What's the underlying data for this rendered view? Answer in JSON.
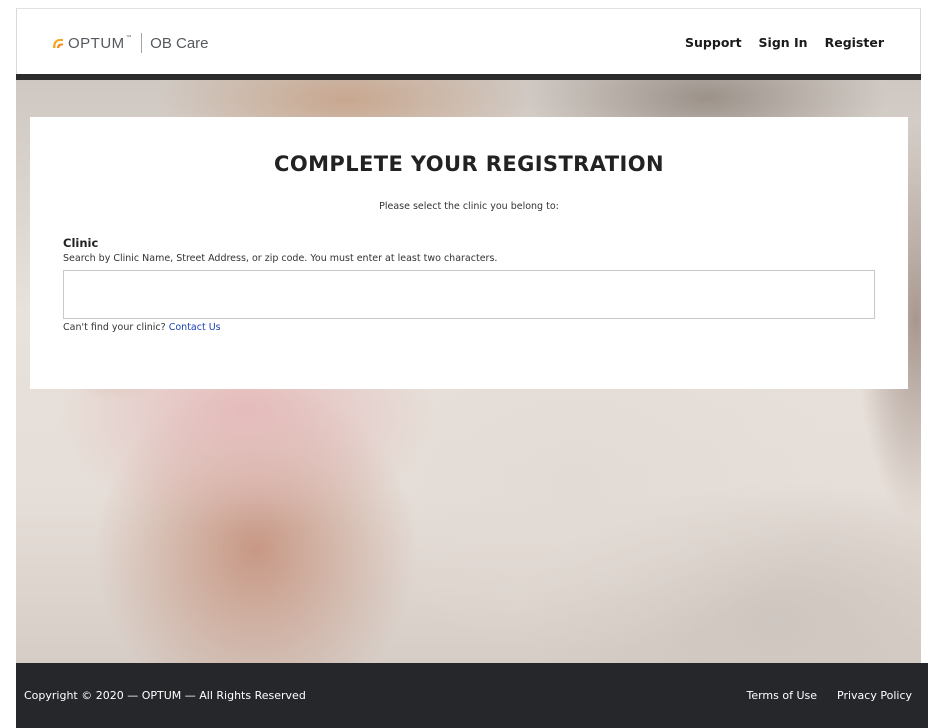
{
  "header": {
    "brand": "OPTUM",
    "brand_tm": "™",
    "product": "OB Care",
    "nav": {
      "support": "Support",
      "sign_in": "Sign In",
      "register": "Register"
    }
  },
  "card": {
    "title": "COMPLETE YOUR REGISTRATION",
    "subtitle": "Please select the clinic you belong to:",
    "clinic_label": "Clinic",
    "clinic_help": "Search by Clinic Name, Street Address, or zip code. You must enter at least two characters.",
    "clinic_input_value": "",
    "cant_find_text": "Can't find your clinic?",
    "contact_link": "Contact Us"
  },
  "footer": {
    "copyright": "Copyright © 2020 — OPTUM — All Rights Reserved",
    "terms": "Terms of Use",
    "privacy": "Privacy Policy"
  },
  "colors": {
    "brand_orange": "#f5a623",
    "header_bar": "#2c2c2c",
    "footer_bg": "#26272b",
    "link_blue": "#1a3fb3"
  },
  "icons": {
    "logo_mark": "optum-logo-icon"
  }
}
